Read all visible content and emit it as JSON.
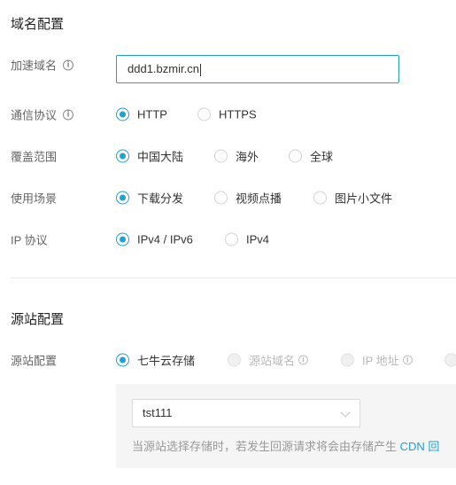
{
  "domain_section": {
    "title": "域名配置",
    "accelerated_domain": {
      "label": "加速域名",
      "value": "ddd1.bzmir.cn"
    },
    "protocol": {
      "label": "通信协议",
      "options": [
        "HTTP",
        "HTTPS"
      ],
      "selected": "HTTP"
    },
    "coverage": {
      "label": "覆盖范围",
      "options": [
        "中国大陆",
        "海外",
        "全球"
      ],
      "selected": "中国大陆"
    },
    "scenario": {
      "label": "使用场景",
      "options": [
        "下载分发",
        "视频点播",
        "图片小文件"
      ],
      "selected": "下载分发"
    },
    "ip_protocol": {
      "label": "IP 协议",
      "options": [
        "IPv4 / IPv6",
        "IPv4"
      ],
      "selected": "IPv4 / IPv6"
    }
  },
  "origin_section": {
    "title": "源站配置",
    "origin": {
      "label": "源站配置",
      "options": [
        "七牛云存储",
        "源站域名",
        "IP 地址"
      ],
      "selected": "七牛云存储",
      "disabled": [
        "源站域名",
        "IP 地址"
      ]
    },
    "bucket_select": {
      "value": "tst111"
    },
    "hint": {
      "text": "当源站选择存储时，若发生回源请求将会由存储产生 ",
      "link": "CDN 回"
    }
  },
  "colors": {
    "accent": "#1ea0d8",
    "label": "#666666",
    "hint": "#999999"
  },
  "icons": [
    "info-icon",
    "chevron-down-icon"
  ]
}
